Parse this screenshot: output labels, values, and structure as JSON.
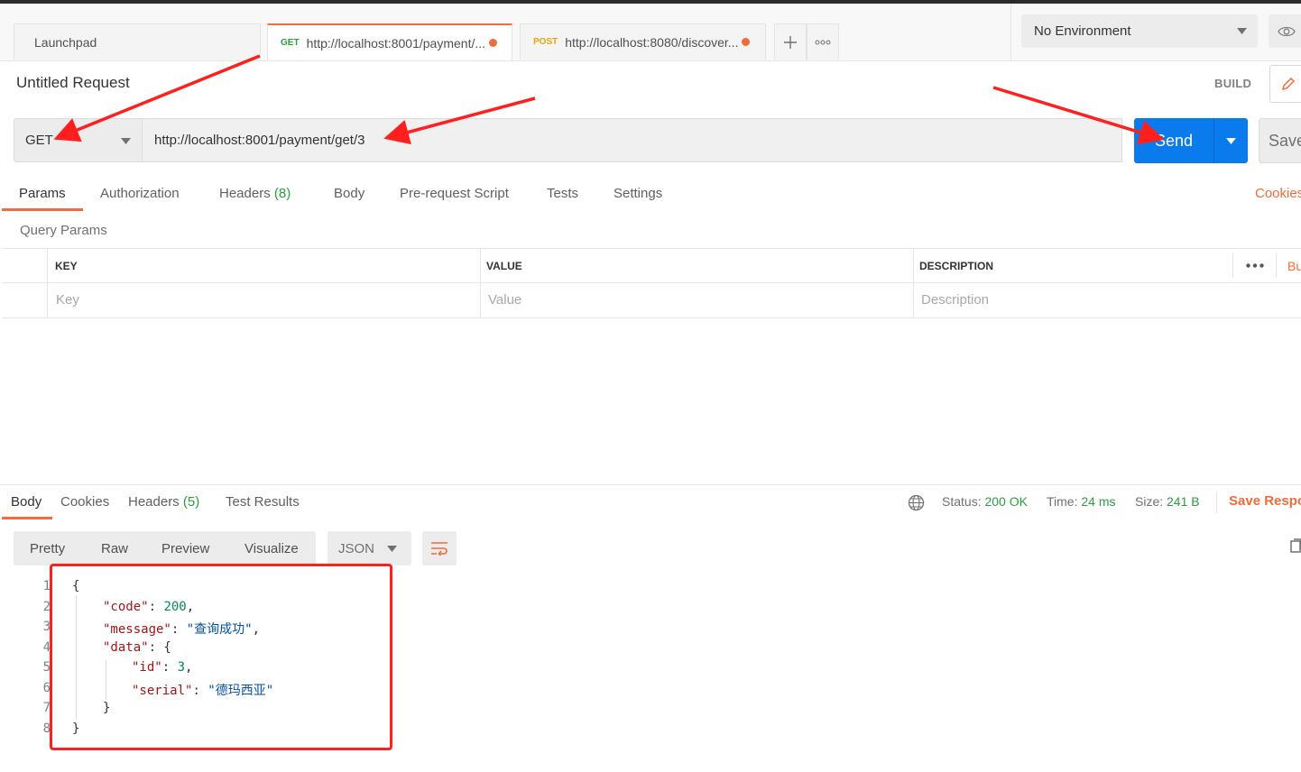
{
  "tabs": {
    "launchpad": "Launchpad",
    "items": [
      {
        "method": "GET",
        "url": "http://localhost:8001/payment/...",
        "method_color": "#2a9d3f"
      },
      {
        "method": "POST",
        "url": "http://localhost:8080/discover...",
        "method_color": "#e8a50c"
      }
    ],
    "add_icon": "plus-icon",
    "more_icon": "ellipsis-icon"
  },
  "environment": {
    "selected": "No Environment",
    "eye_icon": "eye-icon"
  },
  "request": {
    "title": "Untitled Request",
    "mode_label": "BUILD",
    "method": "GET",
    "url": "http://localhost:8001/payment/get/3",
    "send_label": "Send",
    "save_label": "Save"
  },
  "request_tabs": {
    "params": "Params",
    "authorization": "Authorization",
    "headers": "Headers",
    "headers_count": "(8)",
    "body": "Body",
    "prerequest": "Pre-request Script",
    "tests": "Tests",
    "settings": "Settings",
    "cookies": "Cookies"
  },
  "query_params": {
    "title": "Query Params",
    "columns": [
      "KEY",
      "VALUE",
      "DESCRIPTION"
    ],
    "placeholders": [
      "Key",
      "Value",
      "Description"
    ],
    "bulk_edit": "Bu"
  },
  "response": {
    "tabs": {
      "body": "Body",
      "cookies": "Cookies",
      "headers": "Headers",
      "headers_count": "(5)",
      "test_results": "Test Results"
    },
    "status_label": "Status:",
    "status_value": "200 OK",
    "time_label": "Time:",
    "time_value": "24 ms",
    "size_label": "Size:",
    "size_value": "241 B",
    "save_response": "Save Respo",
    "formats": [
      "Pretty",
      "Raw",
      "Preview",
      "Visualize"
    ],
    "format_select": "JSON",
    "line_numbers": [
      "1",
      "2",
      "3",
      "4",
      "5",
      "6",
      "7",
      "8"
    ],
    "json": {
      "open_brace": "{",
      "code_key": "\"code\"",
      "code_val": "200",
      "message_key": "\"message\"",
      "message_val": "\"查询成功\"",
      "data_key": "\"data\"",
      "id_key": "\"id\"",
      "id_val": "3",
      "serial_key": "\"serial\"",
      "serial_val": "\"德玛西亚\"",
      "inner_close": "}",
      "close_brace": "}"
    }
  },
  "accent_color": "#f26b3a",
  "send_color": "#097bed"
}
